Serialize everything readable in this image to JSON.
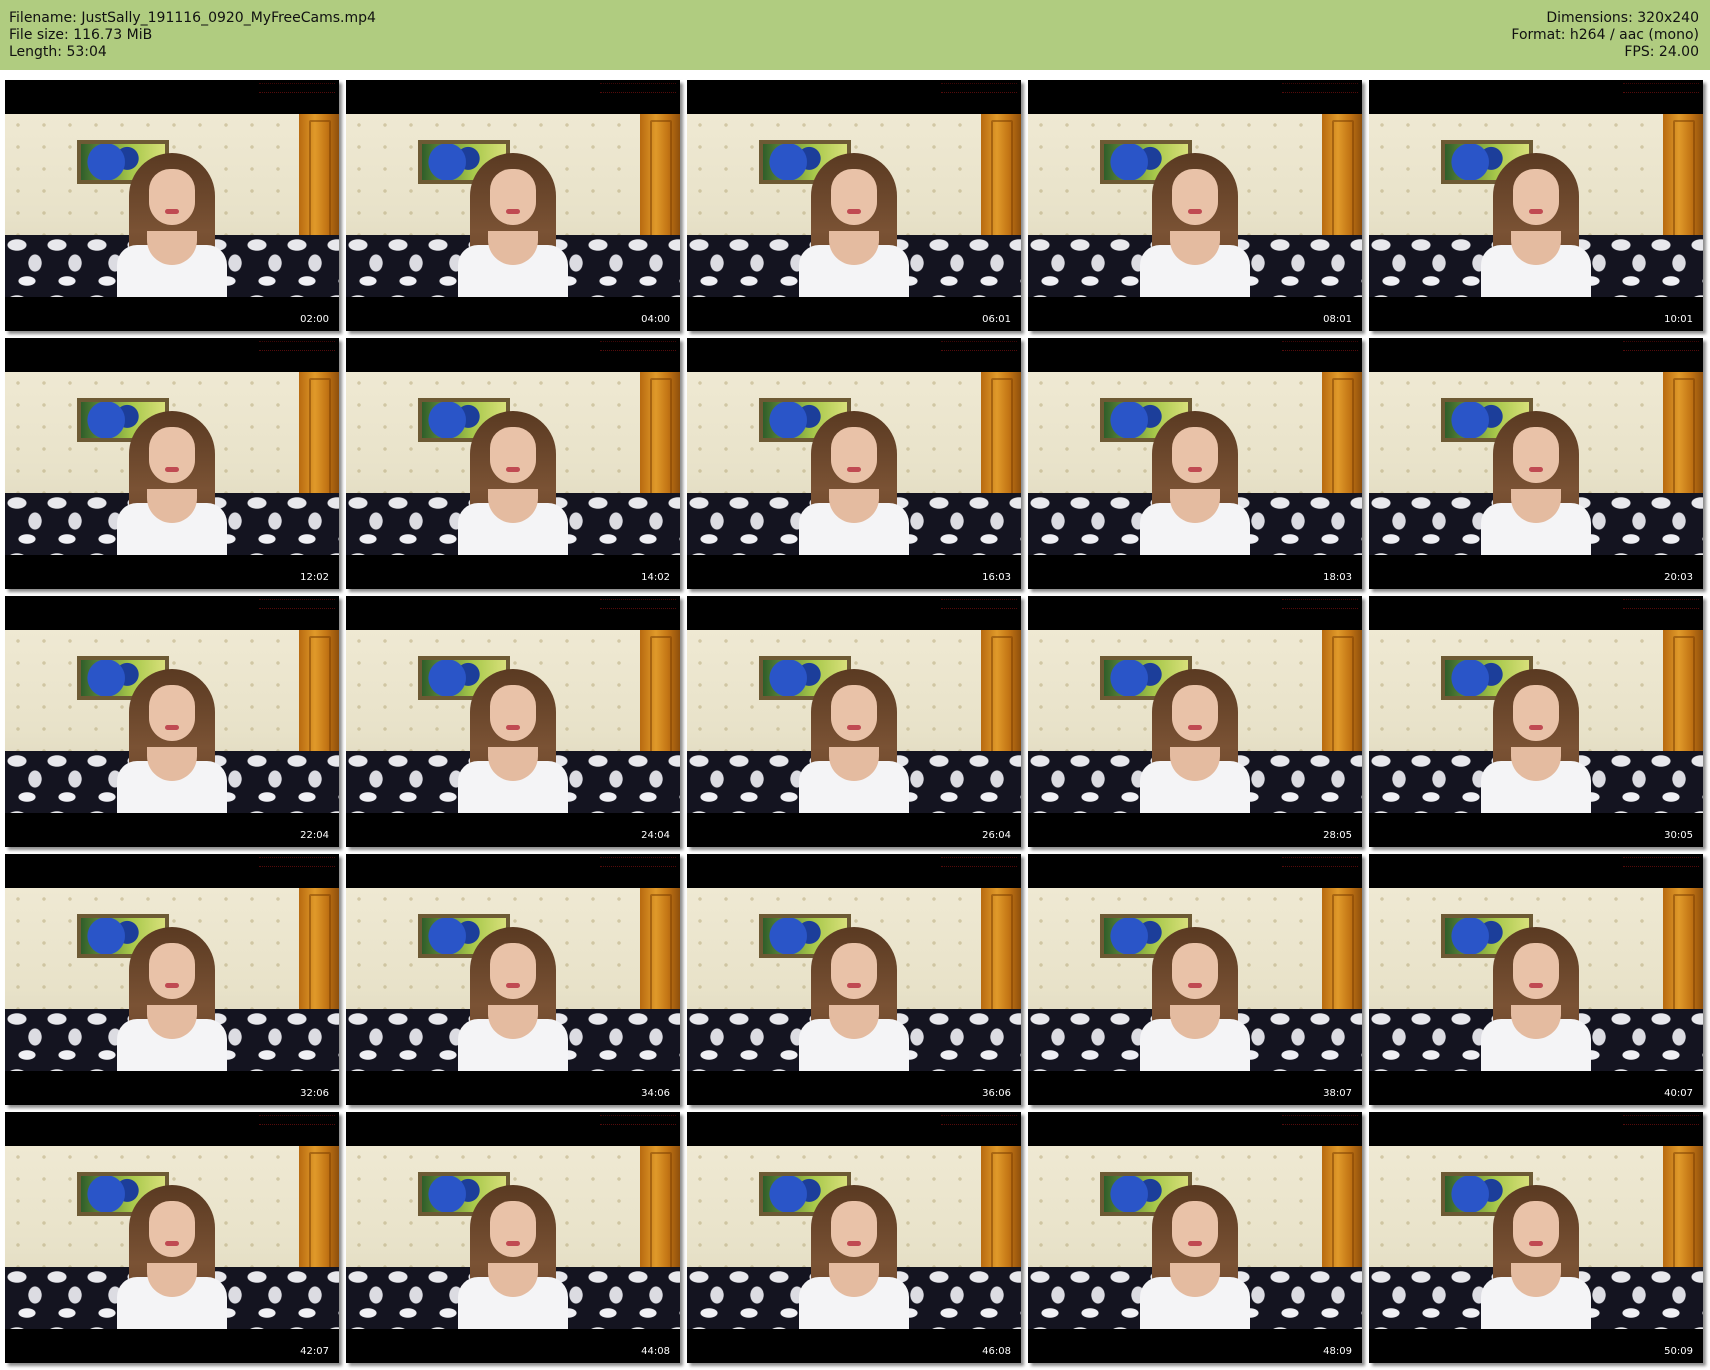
{
  "header": {
    "filename_label": "Filename:",
    "filename": "JustSally_191116_0920_MyFreeCams.mp4",
    "filesize_label": "File size:",
    "filesize": "116.73 MiB",
    "length_label": "Length:",
    "length": "53:04",
    "dimensions_label": "Dimensions:",
    "dimensions": "320x240",
    "format_label": "Format:",
    "format": "h264 / aac (mono)",
    "fps_label": "FPS:",
    "fps": "24.00"
  },
  "thumbnails": [
    {
      "timestamp": "02:00"
    },
    {
      "timestamp": "04:00"
    },
    {
      "timestamp": "06:01"
    },
    {
      "timestamp": "08:01"
    },
    {
      "timestamp": "10:01"
    },
    {
      "timestamp": "12:02"
    },
    {
      "timestamp": "14:02"
    },
    {
      "timestamp": "16:03"
    },
    {
      "timestamp": "18:03"
    },
    {
      "timestamp": "20:03"
    },
    {
      "timestamp": "22:04"
    },
    {
      "timestamp": "24:04"
    },
    {
      "timestamp": "26:04"
    },
    {
      "timestamp": "28:05"
    },
    {
      "timestamp": "30:05"
    },
    {
      "timestamp": "32:06"
    },
    {
      "timestamp": "34:06"
    },
    {
      "timestamp": "36:06"
    },
    {
      "timestamp": "38:07"
    },
    {
      "timestamp": "40:07"
    },
    {
      "timestamp": "42:07"
    },
    {
      "timestamp": "44:08"
    },
    {
      "timestamp": "46:08"
    },
    {
      "timestamp": "48:09"
    },
    {
      "timestamp": "50:09"
    }
  ],
  "colors": {
    "header_background": "#b0cc80",
    "thumbnail_background": "#000000",
    "timestamp_text": "#ffffff"
  }
}
